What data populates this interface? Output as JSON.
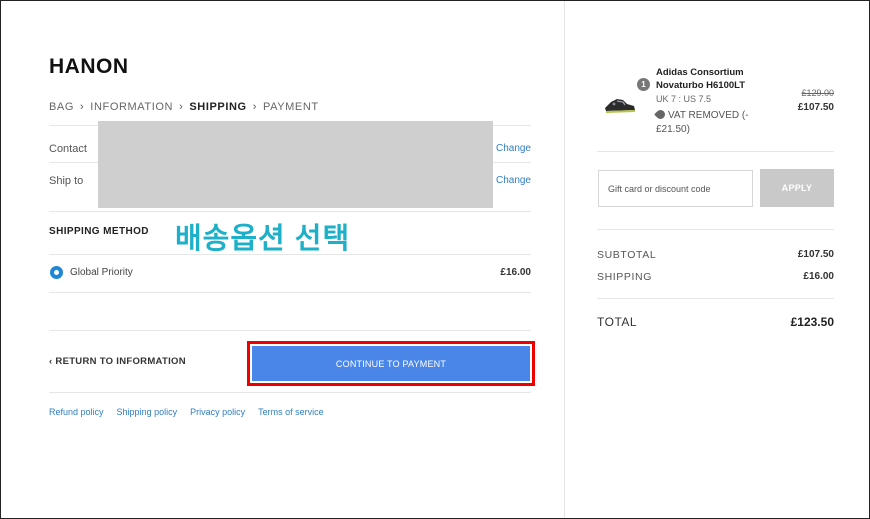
{
  "brand": "HANON",
  "breadcrumb": [
    "BAG",
    "INFORMATION",
    "SHIPPING",
    "PAYMENT"
  ],
  "breadcrumb_active": "SHIPPING",
  "contact": {
    "label": "Contact",
    "change": "Change"
  },
  "ship_to": {
    "label": "Ship to",
    "change": "Change"
  },
  "shipping_method": {
    "heading": "SHIPPING METHOD",
    "annotation": "배송옵션 선택",
    "option": {
      "name": "Global Priority",
      "price": "£16.00",
      "selected": true
    }
  },
  "actions": {
    "return_label": "RETURN TO INFORMATION",
    "continue_label": "CONTINUE TO PAYMENT",
    "continue_color": "#4a86e8",
    "highlight_color": "#ee0000"
  },
  "footer_links": [
    "Refund policy",
    "Shipping policy",
    "Privacy policy",
    "Terms of service"
  ],
  "order": {
    "quantity": "1",
    "product_name": "Adidas Consortium Novaturbo H6100LT",
    "variant": "UK 7 : US 7.5",
    "vat_note": "VAT REMOVED (-£21.50)",
    "old_price": "£129.00",
    "price": "£107.50"
  },
  "discount": {
    "placeholder": "Gift card or discount code",
    "apply_label": "APPLY"
  },
  "summary": {
    "subtotal_label": "SUBTOTAL",
    "subtotal": "£107.50",
    "shipping_label": "SHIPPING",
    "shipping": "£16.00",
    "total_label": "TOTAL",
    "total": "£123.50"
  }
}
